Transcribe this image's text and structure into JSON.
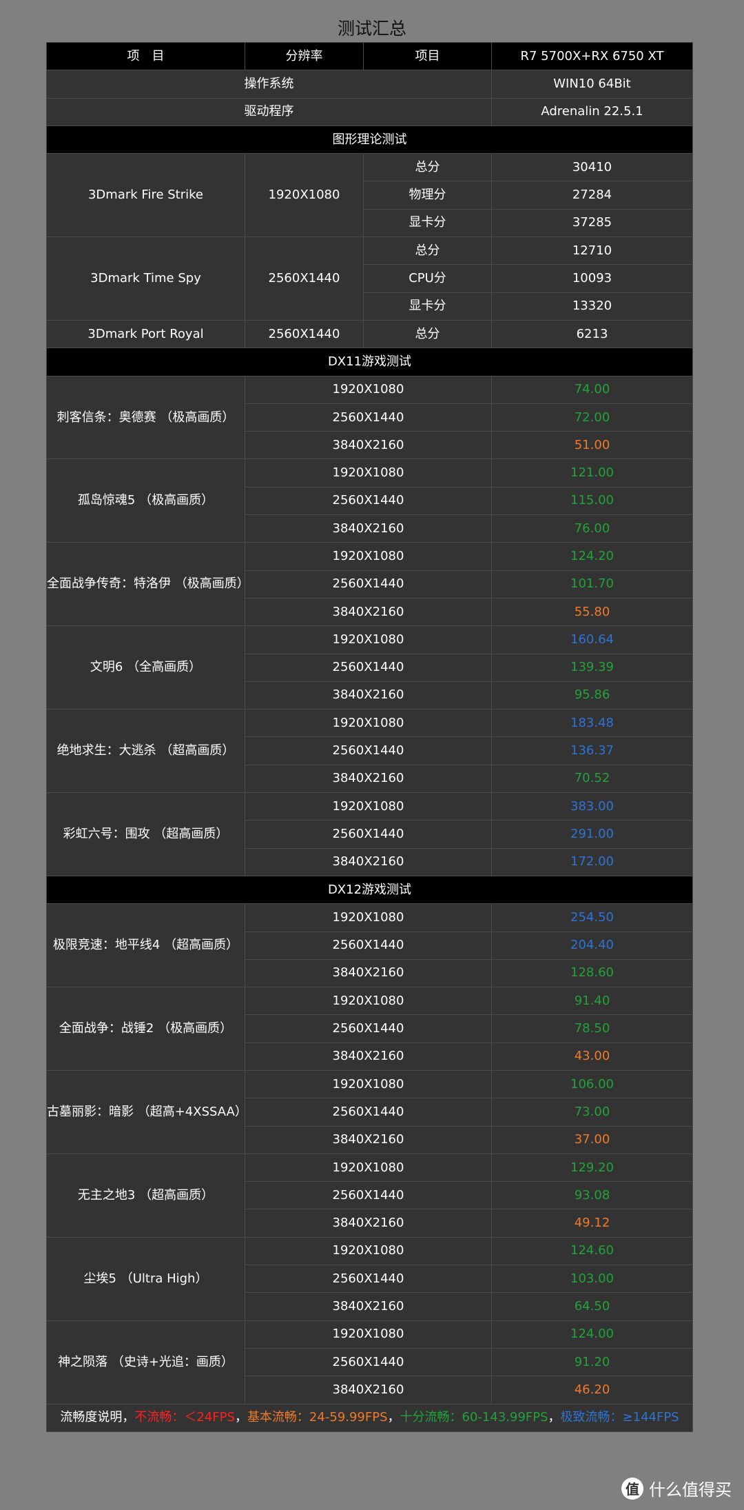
{
  "title": "测试汇总",
  "colors": {
    "green": "#22a33a",
    "orange": "#f07a2a",
    "blue": "#2f73d4",
    "red": "#ff2020"
  },
  "header": {
    "col1": "项　目",
    "col2": "分辨率",
    "col3": "项目",
    "col4": "R7 5700X+RX 6750 XT"
  },
  "info": [
    {
      "label": "操作系统",
      "value": "WIN10 64Bit"
    },
    {
      "label": "驱动程序",
      "value": "Adrenalin 22.5.1"
    }
  ],
  "theory_section": "图形理论测试",
  "benchmarks": [
    {
      "name": "3Dmark Fire Strike",
      "resolution": "1920X1080",
      "rows": [
        {
          "item": "总分",
          "score": "30410"
        },
        {
          "item": "物理分",
          "score": "27284"
        },
        {
          "item": "显卡分",
          "score": "37285"
        }
      ]
    },
    {
      "name": "3Dmark\nTime Spy",
      "resolution": "2560X1440",
      "rows": [
        {
          "item": "总分",
          "score": "12710"
        },
        {
          "item": "CPU分",
          "score": "10093"
        },
        {
          "item": "显卡分",
          "score": "13320"
        }
      ]
    },
    {
      "name": "3Dmark Port Royal",
      "resolution": "2560X1440",
      "rows": [
        {
          "item": "总分",
          "score": "6213"
        }
      ]
    }
  ],
  "sections": [
    {
      "title": "DX11游戏测试",
      "games": [
        {
          "name": "刺客信条：奥德赛\n（极高画质）",
          "results": [
            {
              "res": "1920X1080",
              "fps": "74.00",
              "color": "green"
            },
            {
              "res": "2560X1440",
              "fps": "72.00",
              "color": "green"
            },
            {
              "res": "3840X2160",
              "fps": "51.00",
              "color": "orange"
            }
          ]
        },
        {
          "name": "孤岛惊魂5\n（极高画质）",
          "results": [
            {
              "res": "1920X1080",
              "fps": "121.00",
              "color": "green"
            },
            {
              "res": "2560X1440",
              "fps": "115.00",
              "color": "green"
            },
            {
              "res": "3840X2160",
              "fps": "76.00",
              "color": "green"
            }
          ]
        },
        {
          "name": "全面战争传奇：特洛伊\n（极高画质）",
          "results": [
            {
              "res": "1920X1080",
              "fps": "124.20",
              "color": "green"
            },
            {
              "res": "2560X1440",
              "fps": "101.70",
              "color": "green"
            },
            {
              "res": "3840X2160",
              "fps": "55.80",
              "color": "orange"
            }
          ]
        },
        {
          "name": "文明6\n（全高画质）",
          "results": [
            {
              "res": "1920X1080",
              "fps": "160.64",
              "color": "blue"
            },
            {
              "res": "2560X1440",
              "fps": "139.39",
              "color": "green"
            },
            {
              "res": "3840X2160",
              "fps": "95.86",
              "color": "green"
            }
          ]
        },
        {
          "name": "绝地求生：大逃杀\n（超高画质）",
          "results": [
            {
              "res": "1920X1080",
              "fps": "183.48",
              "color": "blue"
            },
            {
              "res": "2560X1440",
              "fps": "136.37",
              "color": "blue"
            },
            {
              "res": "3840X2160",
              "fps": "70.52",
              "color": "green"
            }
          ]
        },
        {
          "name": "彩虹六号：围攻\n（超高画质）",
          "results": [
            {
              "res": "1920X1080",
              "fps": "383.00",
              "color": "blue"
            },
            {
              "res": "2560X1440",
              "fps": "291.00",
              "color": "blue"
            },
            {
              "res": "3840X2160",
              "fps": "172.00",
              "color": "blue"
            }
          ]
        }
      ]
    },
    {
      "title": "DX12游戏测试",
      "games": [
        {
          "name": "极限竞速：地平线4\n（超高画质）",
          "results": [
            {
              "res": "1920X1080",
              "fps": "254.50",
              "color": "blue"
            },
            {
              "res": "2560X1440",
              "fps": "204.40",
              "color": "blue"
            },
            {
              "res": "3840X2160",
              "fps": "128.60",
              "color": "green"
            }
          ]
        },
        {
          "name": "全面战争：战锤2\n（极高画质）",
          "results": [
            {
              "res": "1920X1080",
              "fps": "91.40",
              "color": "green"
            },
            {
              "res": "2560X1440",
              "fps": "78.50",
              "color": "green"
            },
            {
              "res": "3840X2160",
              "fps": "43.00",
              "color": "orange"
            }
          ]
        },
        {
          "name": "古墓丽影：暗影\n（超高+4XSSAA）",
          "results": [
            {
              "res": "1920X1080",
              "fps": "106.00",
              "color": "green"
            },
            {
              "res": "2560X1440",
              "fps": "73.00",
              "color": "green"
            },
            {
              "res": "3840X2160",
              "fps": "37.00",
              "color": "orange"
            }
          ]
        },
        {
          "name": "无主之地3\n（超高画质）",
          "results": [
            {
              "res": "1920X1080",
              "fps": "129.20",
              "color": "green"
            },
            {
              "res": "2560X1440",
              "fps": "93.08",
              "color": "green"
            },
            {
              "res": "3840X2160",
              "fps": "49.12",
              "color": "orange"
            }
          ]
        },
        {
          "name": "尘埃5\n（Ultra High）",
          "results": [
            {
              "res": "1920X1080",
              "fps": "124.60",
              "color": "green"
            },
            {
              "res": "2560X1440",
              "fps": "103.00",
              "color": "green"
            },
            {
              "res": "3840X2160",
              "fps": "64.50",
              "color": "green"
            }
          ]
        },
        {
          "name": "神之陨落\n（史诗+光追：画质）",
          "results": [
            {
              "res": "1920X1080",
              "fps": "124.00",
              "color": "green"
            },
            {
              "res": "2560X1440",
              "fps": "91.20",
              "color": "green"
            },
            {
              "res": "3840X2160",
              "fps": "46.20",
              "color": "orange"
            }
          ]
        }
      ]
    }
  ],
  "legend": {
    "prefix": "流畅度说明，",
    "items": [
      {
        "text": "不流畅：＜24FPS",
        "color": "red"
      },
      {
        "text": "基本流畅：24-59.99FPS",
        "color": "orange"
      },
      {
        "text": "十分流畅：60-143.99FPS",
        "color": "green"
      },
      {
        "text": "极致流畅：≥144FPS",
        "color": "blue"
      }
    ],
    "separator": "，"
  },
  "watermark": {
    "badge": "值",
    "text": "什么值得买"
  }
}
